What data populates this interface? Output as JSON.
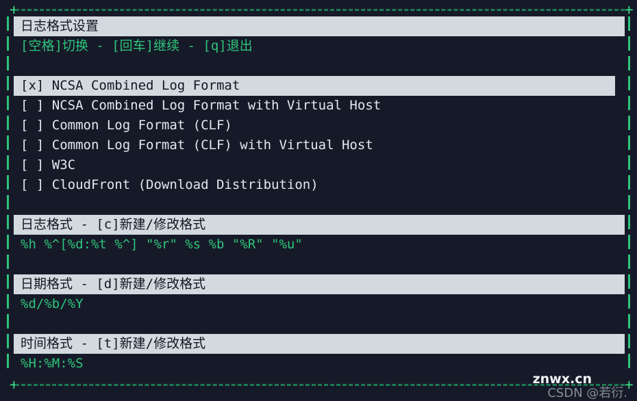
{
  "window": {
    "background_color": "#161a28",
    "border_color": "#2fc47c",
    "border_dash_color": "#1f7a53",
    "corner_glyph": "+"
  },
  "palette": {
    "accent_green": "#2fc47c",
    "header_bg": "#d2dae0",
    "header_fg": "#14161f",
    "body_fg": "#e4e8ef"
  },
  "panel": {
    "title": "日志格式设置",
    "hint": "[空格]切换 - [回车]继续 - [q]退出"
  },
  "format_list": {
    "items": [
      {
        "marker": "[x]",
        "label": "NCSA Combined Log Format",
        "selected": true
      },
      {
        "marker": "[ ]",
        "label": "NCSA Combined Log Format with Virtual Host",
        "selected": false
      },
      {
        "marker": "[ ]",
        "label": "Common Log Format (CLF)",
        "selected": false
      },
      {
        "marker": "[ ]",
        "label": "Common Log Format (CLF) with Virtual Host",
        "selected": false
      },
      {
        "marker": "[ ]",
        "label": "W3C",
        "selected": false
      },
      {
        "marker": "[ ]",
        "label": "CloudFront (Download Distribution)",
        "selected": false
      }
    ]
  },
  "sections": [
    {
      "header": "日志格式 - [c]新建/修改格式",
      "value": "%h %^[%d:%t %^] \"%r\" %s %b \"%R\" \"%u\""
    },
    {
      "header": "日期格式 - [d]新建/修改格式",
      "value": "%d/%b/%Y"
    },
    {
      "header": "时间格式 - [t]新建/修改格式",
      "value": "%H:%M:%S"
    }
  ],
  "watermark": {
    "primary": "znwx.cn",
    "secondary": "CSDN @若衍."
  }
}
